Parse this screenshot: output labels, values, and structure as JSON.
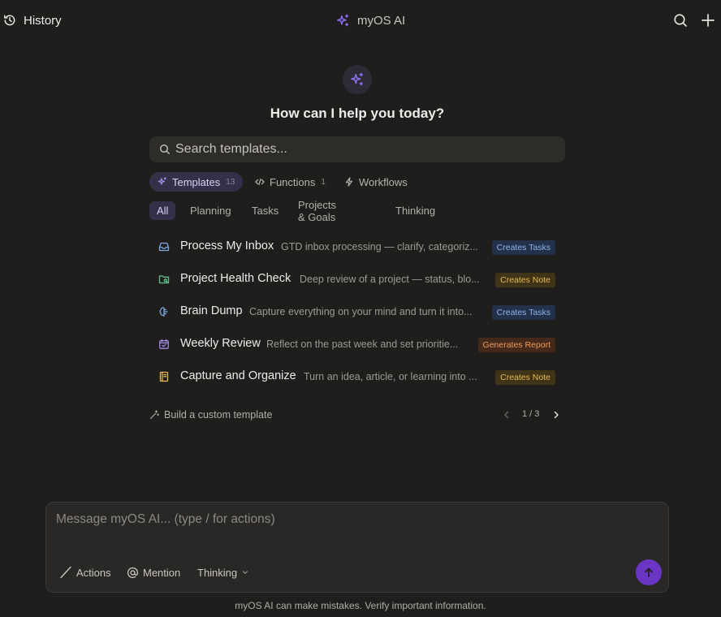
{
  "topbar": {
    "history_label": "History",
    "app_title": "myOS AI"
  },
  "hero": {
    "title": "How can I help you today?"
  },
  "search": {
    "placeholder": "Search templates..."
  },
  "tabs": [
    {
      "label": "Templates",
      "count": "13",
      "icon": "sparkles-icon",
      "active": true
    },
    {
      "label": "Functions",
      "count": "1",
      "icon": "code-icon",
      "active": false
    },
    {
      "label": "Workflows",
      "count": "",
      "icon": "lightning-icon",
      "active": false
    }
  ],
  "filters": [
    "All",
    "Planning",
    "Tasks",
    "Projects & Goals",
    "Thinking"
  ],
  "templates": [
    {
      "name": "Process My Inbox",
      "description": "GTD inbox processing — clarify, categoriz...",
      "tag": "Creates Tasks",
      "icon": "inbox-icon",
      "icon_color": "#7aa7e6"
    },
    {
      "name": "Project Health Check",
      "description": "Deep review of a project — status, blo...",
      "tag": "Creates Note",
      "icon": "folder-search-icon",
      "icon_color": "#5fbf8a"
    },
    {
      "name": "Brain Dump",
      "description": "Capture everything on your mind and turn it into...",
      "tag": "Creates Tasks",
      "icon": "brain-icon",
      "icon_color": "#7aa7e6"
    },
    {
      "name": "Weekly Review",
      "description": "Reflect on the past week and set prioritie...",
      "tag": "Generates Report",
      "icon": "calendar-check-icon",
      "icon_color": "#a88be8"
    },
    {
      "name": "Capture and Organize",
      "description": "Turn an idea, article, or learning into ...",
      "tag": "Creates Note",
      "icon": "notebook-icon",
      "icon_color": "#e7b955"
    }
  ],
  "footer_links": {
    "custom_template": "Build a custom template",
    "page_indicator": "1 / 3"
  },
  "composer": {
    "placeholder": "Message myOS AI... (type / for actions)",
    "actions_label": "Actions",
    "mention_label": "Mention",
    "thinking_label": "Thinking"
  },
  "disclaimer": "myOS AI can make mistakes. Verify important information.",
  "colors": {
    "background": "#1f1e1c",
    "accent": "#6b36c4",
    "active_tab": "#34304a",
    "sparkle": "#8b6cf0"
  }
}
